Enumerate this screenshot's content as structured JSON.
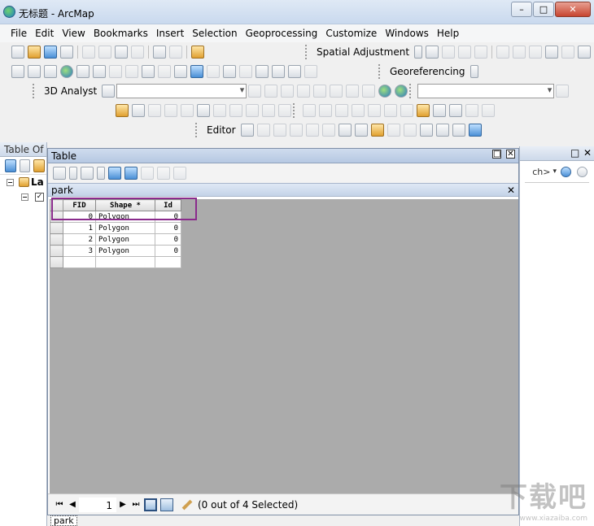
{
  "window": {
    "title": "无标题 - ArcMap",
    "buttons": [
      "–",
      "□",
      "✕"
    ]
  },
  "menu": [
    "File",
    "Edit",
    "View",
    "Bookmarks",
    "Insert",
    "Selection",
    "Geoprocessing",
    "Customize",
    "Windows",
    "Help"
  ],
  "toolbars": {
    "spatial_adjustment": "Spatial Adjustment",
    "georeferencing": "Georeferencing",
    "analyst_3d": "3D Analyst",
    "editor": "Editor"
  },
  "toc": {
    "title": "Table Of",
    "layer_label": "La",
    "check": "✓"
  },
  "right_panel": {
    "search_text": "ch>",
    "buttons": [
      "□",
      "✕"
    ]
  },
  "table_window": {
    "title": "Table",
    "tab_name": "park",
    "columns": [
      "FID",
      "Shape *",
      "Id"
    ],
    "rows": [
      {
        "fid": "0",
        "shape": "Polygon",
        "id": "0"
      },
      {
        "fid": "1",
        "shape": "Polygon",
        "id": "0"
      },
      {
        "fid": "2",
        "shape": "Polygon",
        "id": "0"
      },
      {
        "fid": "3",
        "shape": "Polygon",
        "id": "0"
      }
    ],
    "status": {
      "page": "1",
      "selection": "(0 out of 4 Selected)"
    },
    "bottom_tab": "park"
  },
  "watermark": {
    "main": "下载吧",
    "sub": "www.xiazaiba.com"
  }
}
